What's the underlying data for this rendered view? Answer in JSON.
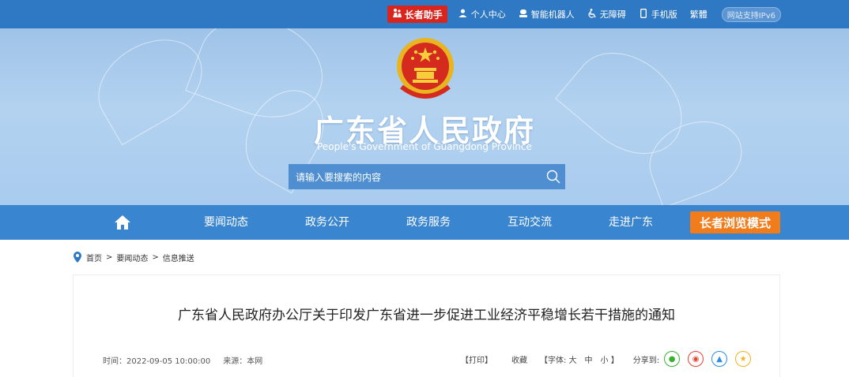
{
  "topbar": {
    "elder_helper": "长者助手",
    "links": [
      "个人中心",
      "智能机器人",
      "无障碍",
      "手机版",
      "繁體"
    ],
    "ipv6": "网站支持IPv6"
  },
  "banner": {
    "title": "广东省人民政府",
    "subtitle": "People's Government of Guangdong Province",
    "search_placeholder": "请输入要搜索的内容"
  },
  "nav": {
    "items": [
      "要闻动态",
      "政务公开",
      "政务服务",
      "互动交流",
      "走进广东"
    ],
    "elder_mode": "长者浏览模式"
  },
  "breadcrumb": {
    "items": [
      "首页",
      "要闻动态",
      "信息推送"
    ],
    "separator": ">"
  },
  "article": {
    "title": "广东省人民政府办公厅关于印发广东省进一步促进工业经济平稳增长若干措施的通知",
    "time": "时间：2022-09-05 10:00:00",
    "source": "来源：本网",
    "print": "【打印】",
    "favorite": "收藏",
    "font_size": "【字体: 大　中　小 】",
    "share_label": "分享到:"
  },
  "colors": {
    "topbar": "#2f78c4",
    "nav": "#3a85cf",
    "elder_red": "#d8261f",
    "elder_orange": "#f07c1c"
  }
}
